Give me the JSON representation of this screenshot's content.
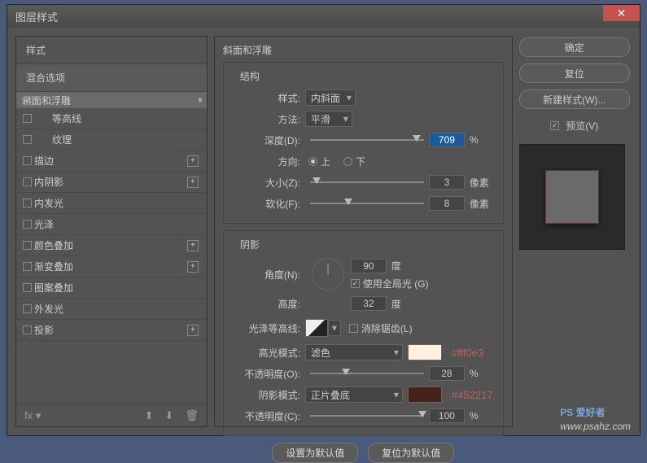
{
  "window": {
    "title": "图层样式"
  },
  "sidebar": {
    "header": "样式",
    "blend": "混合选项",
    "items": [
      {
        "label": "斜面和浮雕",
        "checked": true,
        "selected": true,
        "plus": false,
        "sub": false
      },
      {
        "label": "等高线",
        "checked": false,
        "selected": false,
        "plus": false,
        "sub": true
      },
      {
        "label": "纹理",
        "checked": false,
        "selected": false,
        "plus": false,
        "sub": true
      },
      {
        "label": "描边",
        "checked": false,
        "selected": false,
        "plus": true,
        "sub": false
      },
      {
        "label": "内阴影",
        "checked": false,
        "selected": false,
        "plus": true,
        "sub": false
      },
      {
        "label": "内发光",
        "checked": false,
        "selected": false,
        "plus": false,
        "sub": false
      },
      {
        "label": "光泽",
        "checked": false,
        "selected": false,
        "plus": false,
        "sub": false
      },
      {
        "label": "颜色叠加",
        "checked": false,
        "selected": false,
        "plus": true,
        "sub": false
      },
      {
        "label": "渐变叠加",
        "checked": false,
        "selected": false,
        "plus": true,
        "sub": false
      },
      {
        "label": "图案叠加",
        "checked": false,
        "selected": false,
        "plus": false,
        "sub": false
      },
      {
        "label": "外发光",
        "checked": false,
        "selected": false,
        "plus": false,
        "sub": false
      },
      {
        "label": "投影",
        "checked": false,
        "selected": false,
        "plus": true,
        "sub": false
      }
    ]
  },
  "panel": {
    "title": "斜面和浮雕",
    "structure": {
      "title": "结构",
      "style_label": "样式:",
      "style_value": "内斜面",
      "technique_label": "方法:",
      "technique_value": "平滑",
      "depth_label": "深度(D):",
      "depth_value": "709",
      "depth_unit": "%",
      "direction_label": "方向:",
      "up": "上",
      "down": "下",
      "size_label": "大小(Z):",
      "size_value": "3",
      "size_unit": "像素",
      "soften_label": "软化(F):",
      "soften_value": "8",
      "soften_unit": "像素"
    },
    "shading": {
      "title": "阴影",
      "angle_label": "角度(N):",
      "angle_value": "90",
      "angle_unit": "度",
      "global_label": "使用全局光 (G)",
      "altitude_label": "高度:",
      "altitude_value": "32",
      "altitude_unit": "度",
      "gloss_label": "光泽等高线:",
      "antialias_label": "消除锯齿(L)",
      "highlight_mode_label": "高光模式:",
      "highlight_mode_value": "滤色",
      "highlight_color": "#fff0e3",
      "highlight_hex": "#fff0e3",
      "highlight_opacity_label": "不透明度(O):",
      "highlight_opacity_value": "28",
      "highlight_opacity_unit": "%",
      "shadow_mode_label": "阴影模式:",
      "shadow_mode_value": "正片叠底",
      "shadow_color": "#452217",
      "shadow_hex": "#452217",
      "shadow_opacity_label": "不透明度(C):",
      "shadow_opacity_value": "100",
      "shadow_opacity_unit": "%"
    },
    "default_set": "设置为默认值",
    "default_reset": "复位为默认值"
  },
  "right": {
    "ok": "确定",
    "cancel": "复位",
    "newstyle": "新建样式(W)...",
    "preview": "预览(V)"
  },
  "watermark": {
    "line1": "PS 爱好者",
    "line2": "www.psahz.com"
  }
}
